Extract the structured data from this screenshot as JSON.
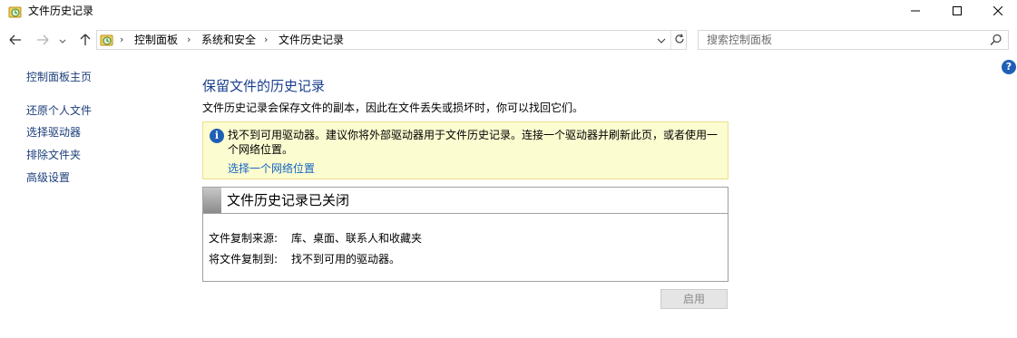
{
  "window": {
    "title": "文件历史记录"
  },
  "nav": {
    "breadcrumb": [
      "控制面板",
      "系统和安全",
      "文件历史记录"
    ],
    "search_placeholder": "搜索控制面板"
  },
  "sidebar": {
    "home_link": "控制面板主页",
    "items": [
      {
        "label": "还原个人文件"
      },
      {
        "label": "选择驱动器"
      },
      {
        "label": "排除文件夹"
      },
      {
        "label": "高级设置"
      }
    ]
  },
  "main": {
    "heading": "保留文件的历史记录",
    "description": "文件历史记录会保存文件的副本，因此在文件丢失或损坏时，你可以找回它们。",
    "info": {
      "message": "找不到可用驱动器。建议你将外部驱动器用于文件历史记录。连接一个驱动器并刷新此页，或者使用一个网络位置。",
      "link": "选择一个网络位置"
    },
    "status": {
      "title": "文件历史记录已关闭",
      "copy_from_label": "文件复制来源:",
      "copy_from_value": "库、桌面、联系人和收藏夹",
      "copy_to_label": "将文件复制到:",
      "copy_to_value": "找不到可用的驱动器。"
    },
    "enable_button": "启用"
  },
  "colors": {
    "link": "#1b3e7a",
    "heading": "#1a3f8f",
    "info_bg": "#fcfcd1",
    "info_border": "#ebe08d"
  }
}
